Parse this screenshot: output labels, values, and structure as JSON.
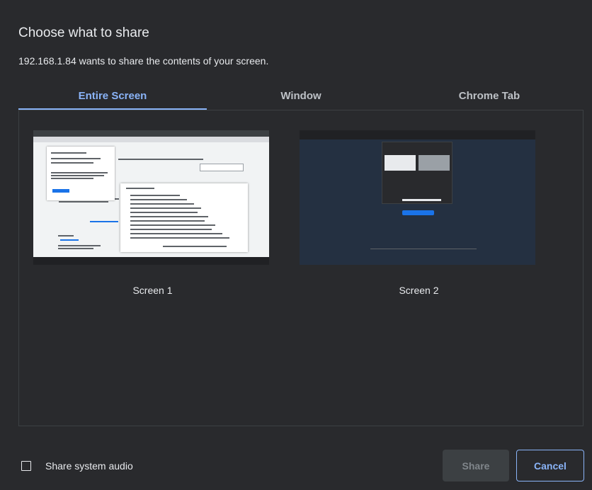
{
  "dialog": {
    "title": "Choose what to share",
    "subtitle": "192.168.1.84 wants to share the contents of your screen."
  },
  "tabs": [
    {
      "label": "Entire Screen",
      "active": true
    },
    {
      "label": "Window",
      "active": false
    },
    {
      "label": "Chrome Tab",
      "active": false
    }
  ],
  "screens": [
    {
      "label": "Screen 1"
    },
    {
      "label": "Screen 2"
    }
  ],
  "footer": {
    "audio_label": "Share system audio",
    "audio_checked": false,
    "share_label": "Share",
    "cancel_label": "Cancel"
  },
  "colors": {
    "background": "#292a2d",
    "accent": "#8ab4f8",
    "text": "#e8eaed"
  }
}
